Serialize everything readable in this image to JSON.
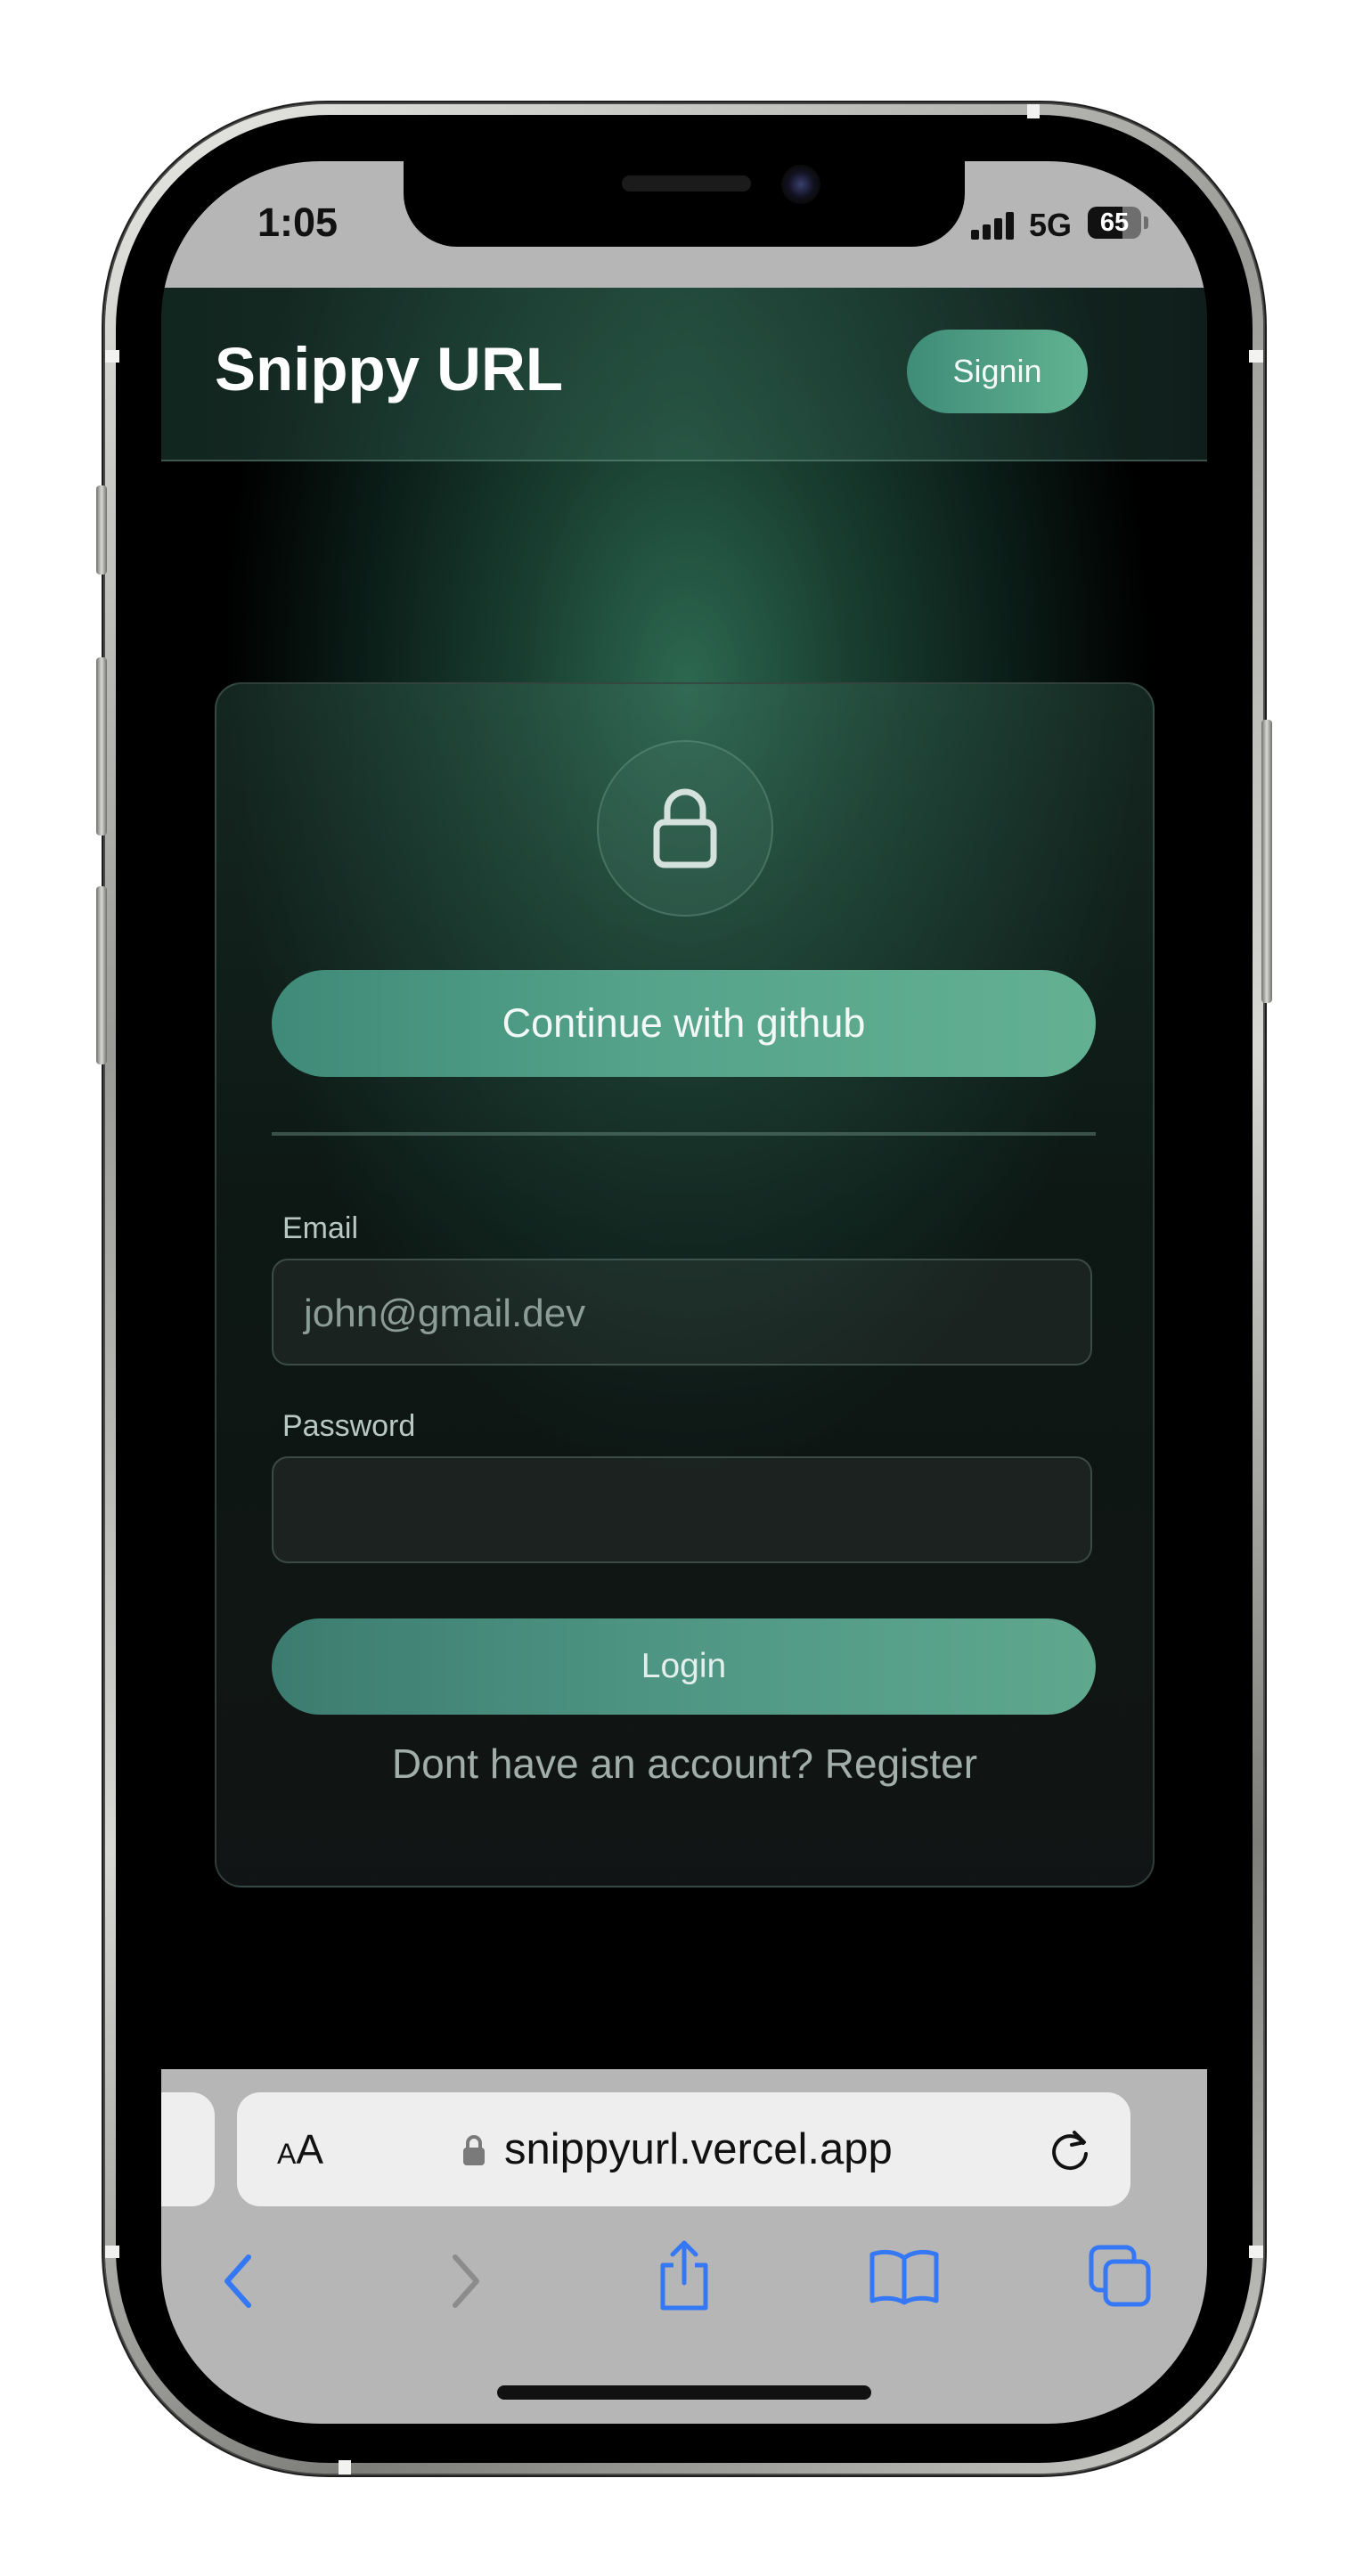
{
  "status_bar": {
    "time": "1:05",
    "network": "5G",
    "battery": "65"
  },
  "header": {
    "brand": "Snippy URL",
    "signin_label": "Signin"
  },
  "login_card": {
    "github_label": "Continue with github",
    "email_label": "Email",
    "email_placeholder": "john@gmail.dev",
    "password_label": "Password",
    "password_value": "",
    "login_label": "Login",
    "register_prompt": "Dont have an account?",
    "register_link": "Register"
  },
  "safari": {
    "text_size_label_small": "A",
    "text_size_label_big": "A",
    "url": "snippyurl.vercel.app",
    "toolbar": {
      "back_icon": "chevron-left-icon",
      "forward_icon": "chevron-right-icon",
      "share_icon": "share-icon",
      "bookmarks_icon": "book-icon",
      "tabs_icon": "tabs-icon"
    }
  },
  "colors": {
    "accent": "#5aa88c",
    "ios_blue": "#3478f6",
    "background": "#0b1a15"
  }
}
